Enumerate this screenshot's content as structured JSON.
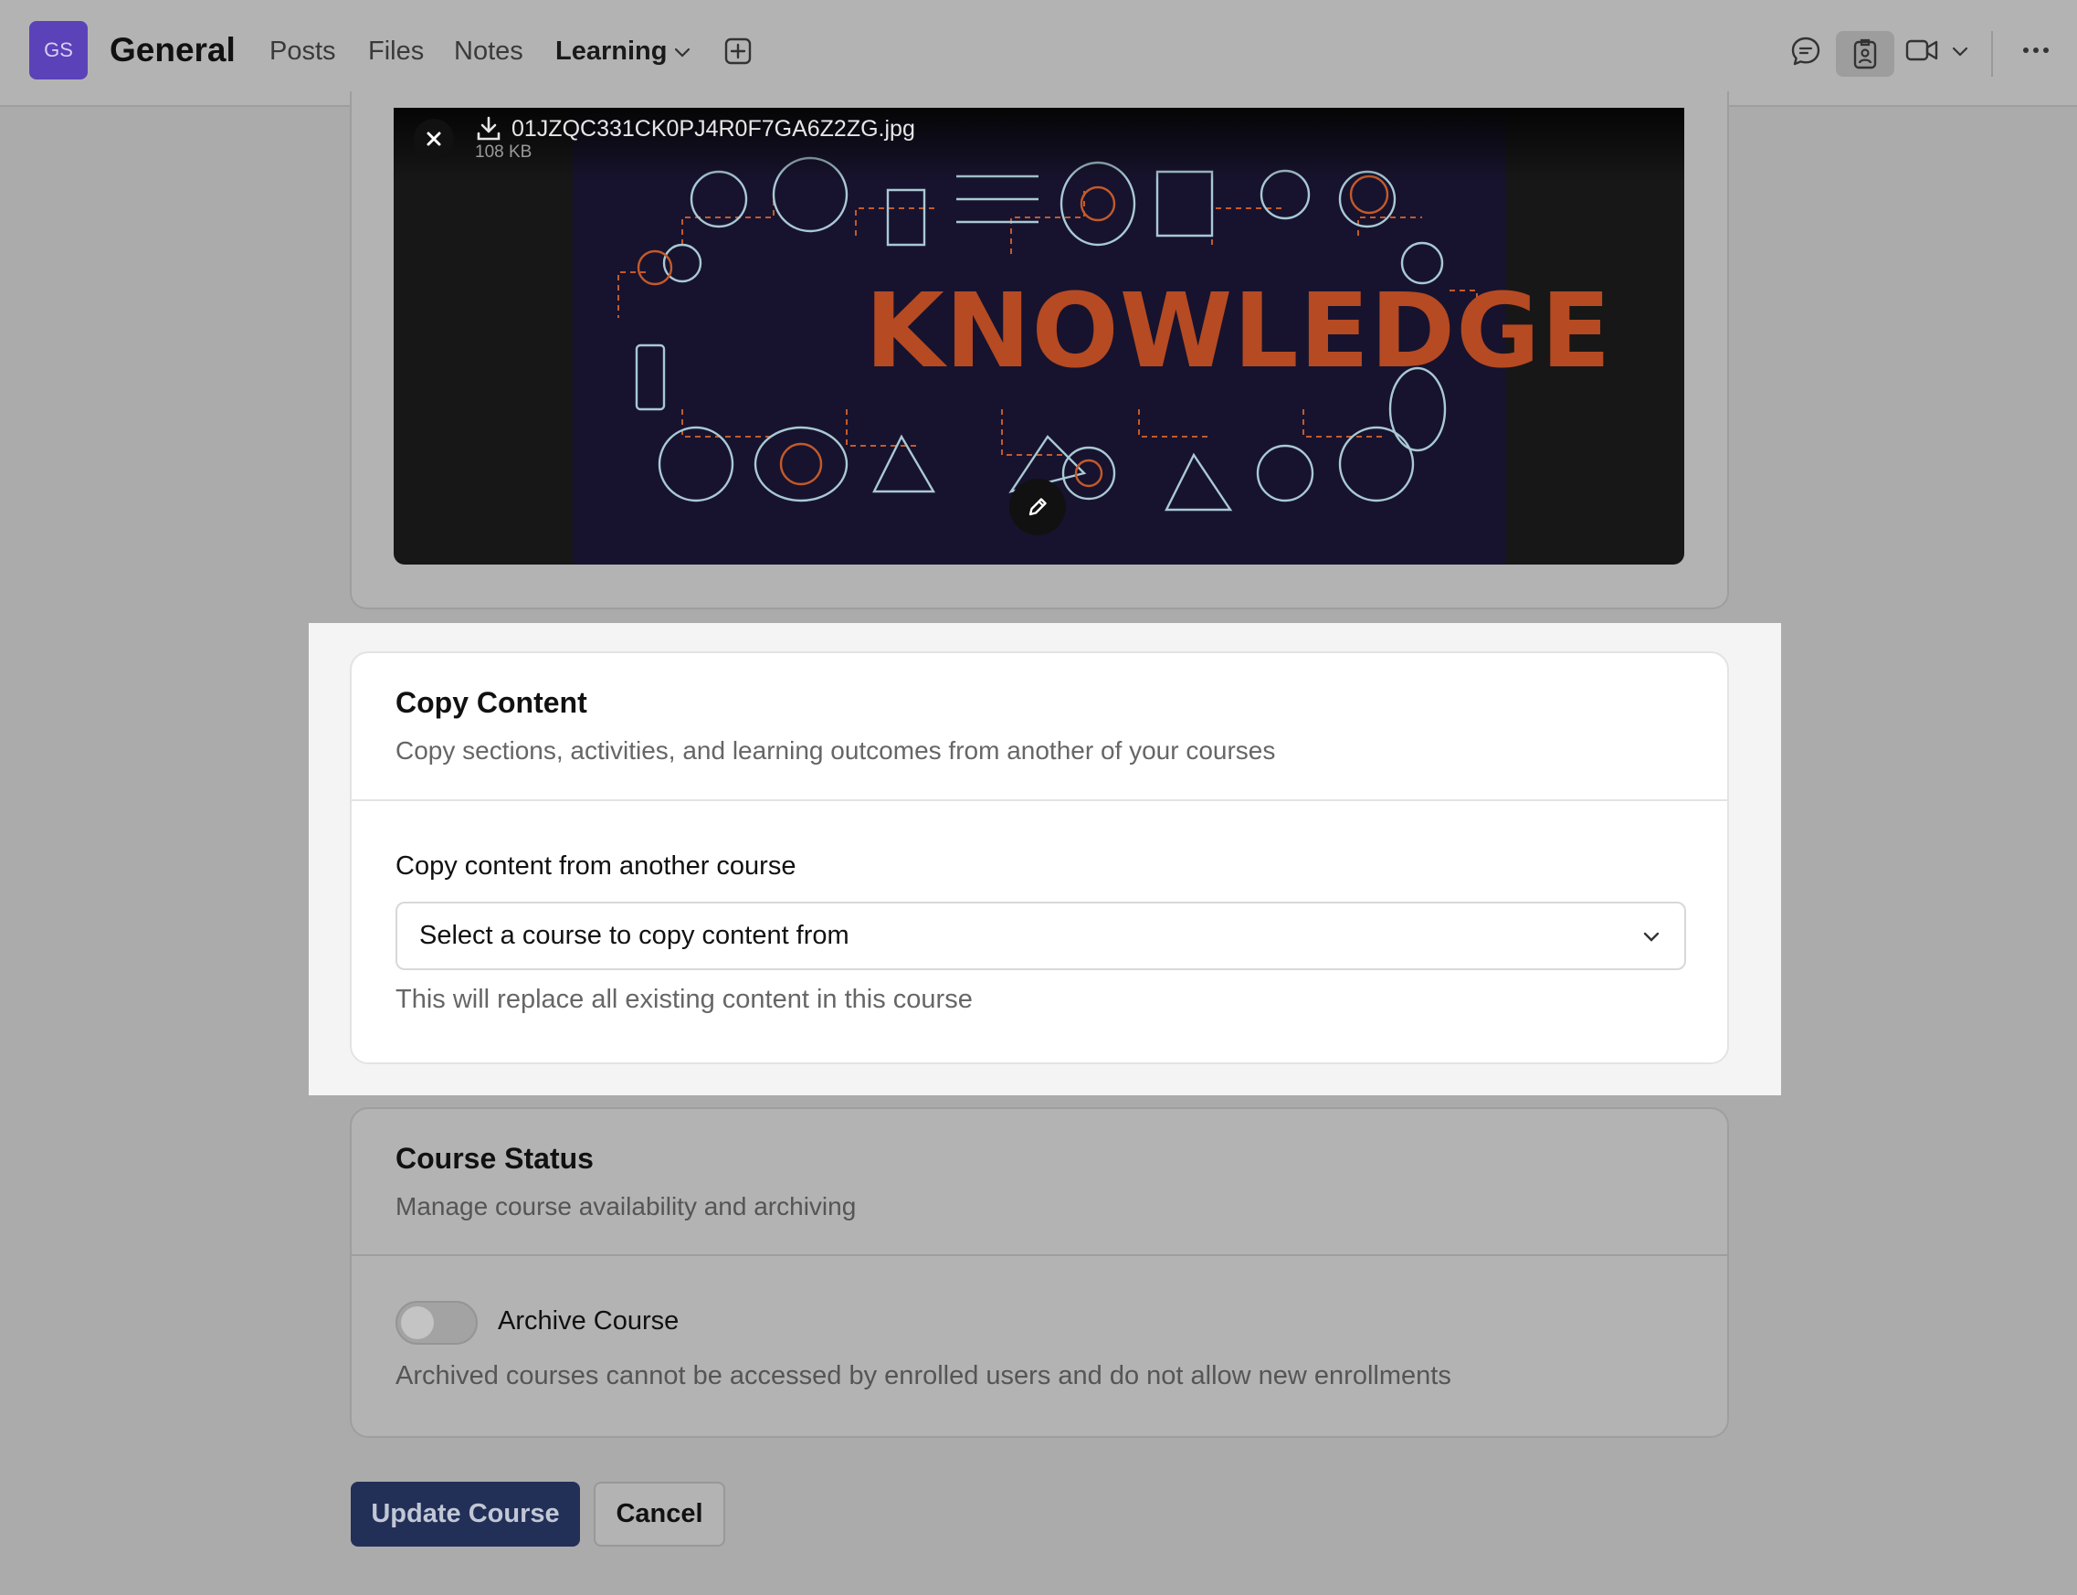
{
  "header": {
    "team_avatar": "GS",
    "team_name": "General",
    "tabs": [
      {
        "label": "Posts"
      },
      {
        "label": "Files"
      },
      {
        "label": "Notes"
      },
      {
        "label": "Learning",
        "active": true
      }
    ],
    "icons": [
      "chevron-down-icon",
      "add-tab-icon",
      "chat-icon",
      "badge-icon",
      "video-icon",
      "more-icon"
    ]
  },
  "viewer": {
    "file_name": "01JZQC331CK0PJ4R0F7GA6Z2ZG.jpg",
    "file_size": "108 KB",
    "image_word": "KNOWLEDGE"
  },
  "copy_content": {
    "title": "Copy Content",
    "subtitle": "Copy sections, activities, and learning outcomes from another of your courses",
    "field_label": "Copy content from another course",
    "select_value": "Select a course to copy content from",
    "help_text": "This will replace all existing content in this course"
  },
  "course_status": {
    "title": "Course Status",
    "subtitle": "Manage course availability and archiving",
    "toggle_label": "Archive Course",
    "toggle_on": false,
    "help_text": "Archived courses cannot be accessed by enrolled users and do not allow new enrollments"
  },
  "actions": {
    "update_label": "Update Course",
    "cancel_label": "Cancel"
  },
  "colors": {
    "accent": "#5b42b8",
    "tab_indicator": "#4b4cae",
    "primary_button": "#223058",
    "knowledge_orange": "#b64a22"
  }
}
